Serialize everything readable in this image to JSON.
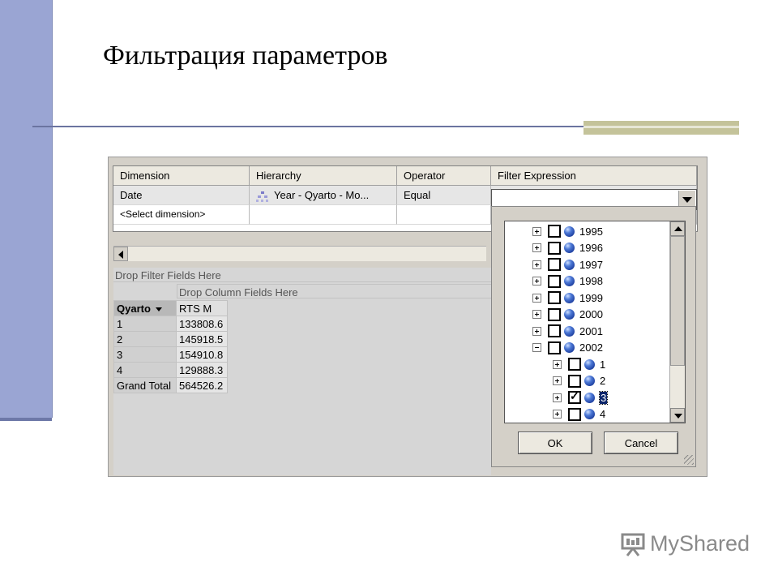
{
  "slide": {
    "title": "Фильтрация параметров"
  },
  "filter_grid": {
    "headers": [
      "Dimension",
      "Hierarchy",
      "Operator",
      "Filter Expression"
    ],
    "rows": [
      {
        "dimension": "Date",
        "hierarchy": "Year - Qyarto - Mo...",
        "operator": "Equal",
        "filter_expression": ""
      },
      {
        "dimension": "<Select dimension>",
        "hierarchy": "",
        "operator": "",
        "filter_expression": ""
      }
    ]
  },
  "pivot": {
    "drop_filter_label": "Drop Filter Fields Here",
    "drop_column_label": "Drop Column Fields Here",
    "row_field": "Qyarto",
    "measure": "RTS M",
    "rows": [
      {
        "label": "1",
        "value": "133808.6"
      },
      {
        "label": "2",
        "value": "145918.5"
      },
      {
        "label": "3",
        "value": "154910.8"
      },
      {
        "label": "4",
        "value": "129888.3"
      },
      {
        "label": "Grand Total",
        "value": "564526.2"
      }
    ]
  },
  "tree": {
    "nodes": [
      {
        "label": "1995",
        "level": 0,
        "expanded": false,
        "checked": false,
        "selected": false
      },
      {
        "label": "1996",
        "level": 0,
        "expanded": false,
        "checked": false,
        "selected": false
      },
      {
        "label": "1997",
        "level": 0,
        "expanded": false,
        "checked": false,
        "selected": false
      },
      {
        "label": "1998",
        "level": 0,
        "expanded": false,
        "checked": false,
        "selected": false
      },
      {
        "label": "1999",
        "level": 0,
        "expanded": false,
        "checked": false,
        "selected": false
      },
      {
        "label": "2000",
        "level": 0,
        "expanded": false,
        "checked": false,
        "selected": false
      },
      {
        "label": "2001",
        "level": 0,
        "expanded": false,
        "checked": false,
        "selected": false
      },
      {
        "label": "2002",
        "level": 0,
        "expanded": true,
        "checked": false,
        "selected": false
      },
      {
        "label": "1",
        "level": 1,
        "expanded": false,
        "checked": false,
        "selected": false
      },
      {
        "label": "2",
        "level": 1,
        "expanded": false,
        "checked": false,
        "selected": false
      },
      {
        "label": "3",
        "level": 1,
        "expanded": false,
        "checked": true,
        "selected": true
      },
      {
        "label": "4",
        "level": 1,
        "expanded": false,
        "checked": false,
        "selected": false
      }
    ]
  },
  "buttons": {
    "ok": "OK",
    "cancel": "Cancel"
  },
  "watermark": {
    "text": "MyShared"
  },
  "colors": {
    "sidebar": "#9aa5d3",
    "title_rule": "#6b74a0",
    "accent": "#c4c39a",
    "selection": "#0a246a"
  }
}
